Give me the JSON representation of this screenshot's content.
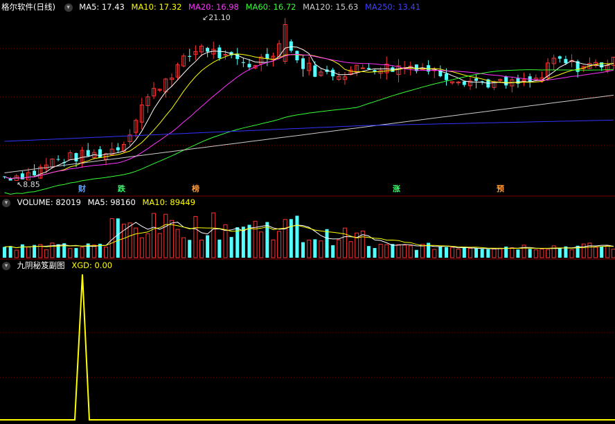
{
  "main_header": {
    "title": "格尔软件(日线)",
    "ma5": "MA5: 17.43",
    "ma10": "MA10: 17.32",
    "ma20": "MA20: 16.98",
    "ma60": "MA60: 16.72",
    "ma120": "MA120: 15.63",
    "ma250": "MA250: 13.41"
  },
  "price_notes": {
    "high": "21.10",
    "low": "8.85"
  },
  "event_tags": [
    {
      "label": "财",
      "color": "#5aa0ff"
    },
    {
      "label": "跌",
      "color": "#33ff66"
    },
    {
      "label": "榜",
      "color": "#ff9933"
    },
    {
      "label": "涨",
      "color": "#33ff66"
    },
    {
      "label": "预",
      "color": "#ff9933"
    }
  ],
  "volume_header": {
    "title": "VOLUME: 82019",
    "ma5": "MA5: 98160",
    "ma10": "MA10: 89449"
  },
  "indicator_header": {
    "title": "九阴秘笈副图",
    "xgd": "XGD: 0.00"
  },
  "colors": {
    "up": "#ff3333",
    "down": "#54ffff",
    "ma5": "#ffffff",
    "ma10": "#ffff00",
    "ma20": "#ff33ff",
    "ma60": "#33ff33",
    "ma120": "#cccccc",
    "ma250": "#3333ff",
    "grid": "#7a0000",
    "xgd": "#ffff00"
  },
  "chart_data": [
    {
      "type": "candlestick",
      "title": "格尔软件(日线)",
      "high": 21.1,
      "low": 8.85,
      "moving_averages": {
        "MA5": 17.43,
        "MA10": 17.32,
        "MA20": 16.98,
        "MA60": 16.72,
        "MA120": 15.63,
        "MA250": 13.41
      }
    },
    {
      "type": "bar",
      "title": "VOLUME",
      "last": 82019,
      "ma5": 98160,
      "ma10": 89449
    },
    {
      "type": "line",
      "title": "九阴秘笈副图",
      "series": [
        {
          "name": "XGD",
          "last": 0.0
        }
      ]
    }
  ]
}
